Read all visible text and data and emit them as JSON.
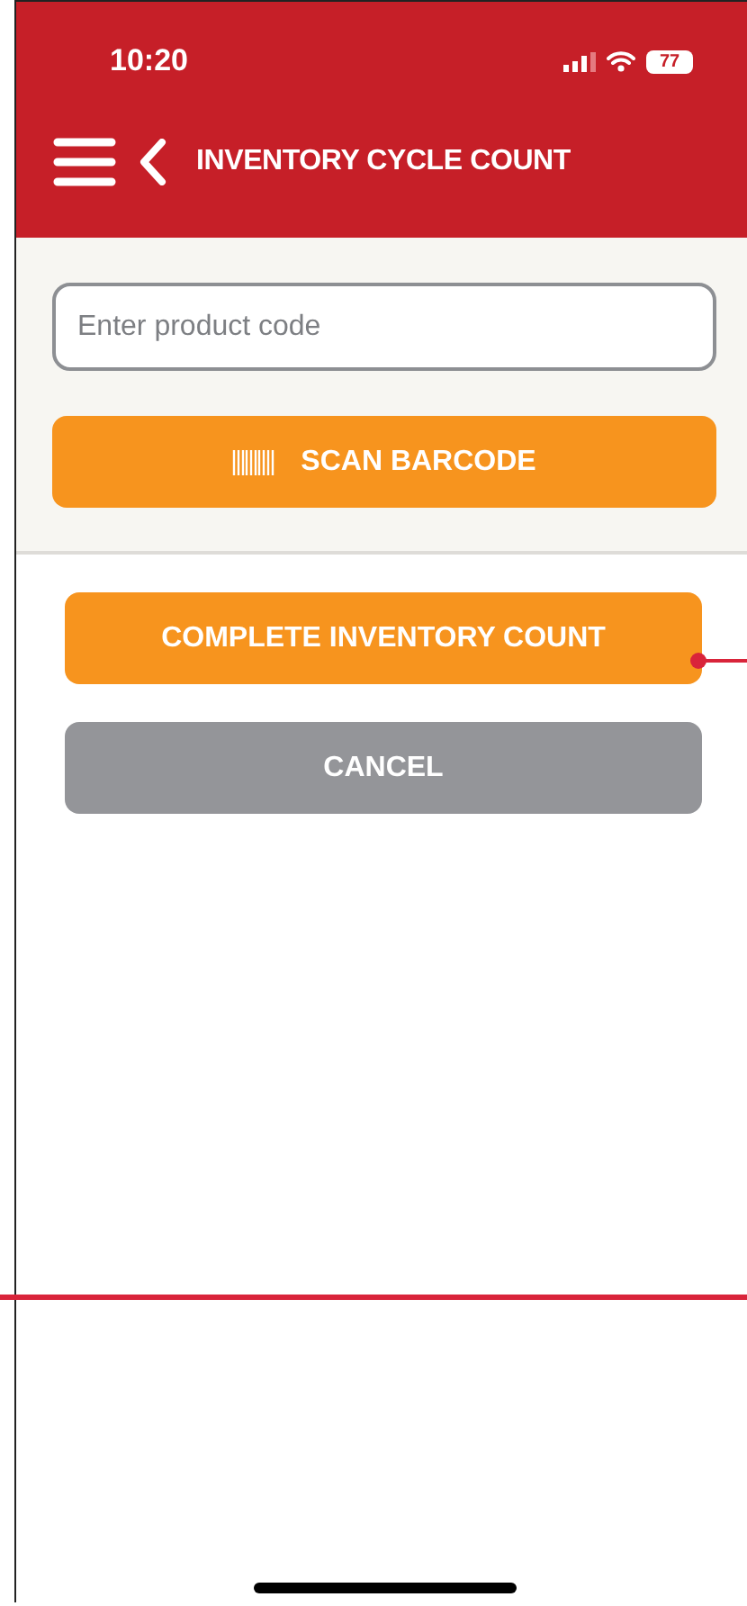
{
  "status_bar": {
    "time": "10:20",
    "battery": "77"
  },
  "header": {
    "title": "INVENTORY CYCLE COUNT"
  },
  "product_code": {
    "placeholder": "Enter product code"
  },
  "scan_button": {
    "label": "SCAN BARCODE"
  },
  "actions": [
    {
      "kind": "primary",
      "label": "COMPLETE INVENTORY COUNT"
    },
    {
      "kind": "secondary",
      "label": "CANCEL"
    }
  ]
}
